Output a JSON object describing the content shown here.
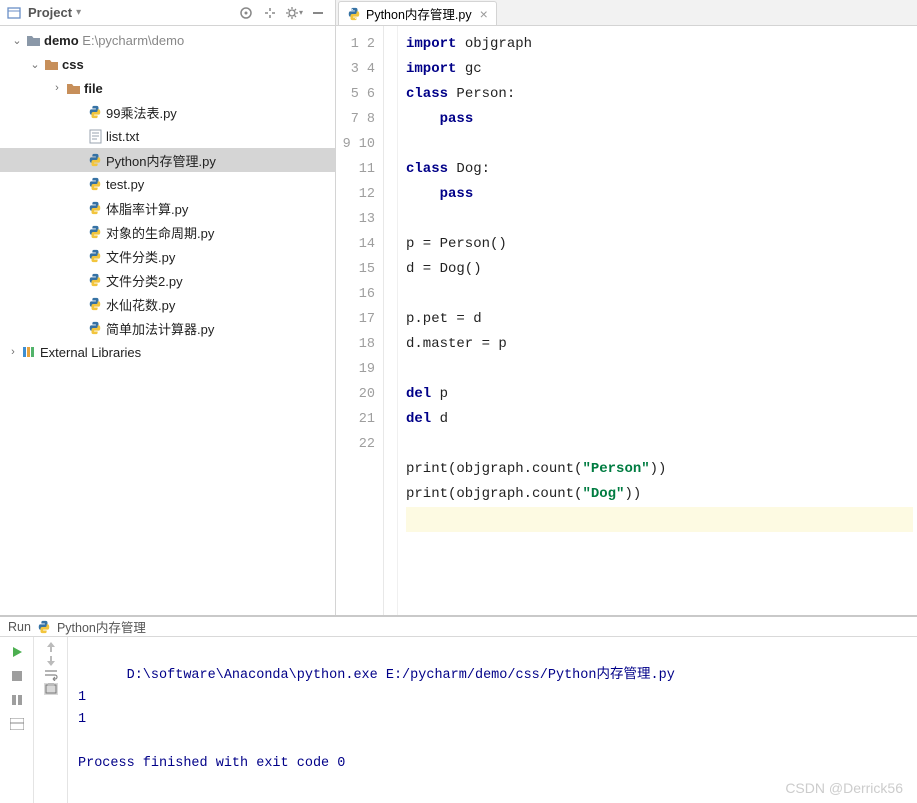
{
  "sidebar": {
    "title": "Project",
    "project": {
      "name": "demo",
      "path": "E:\\pycharm\\demo"
    },
    "folders": {
      "css": "css",
      "file": "file"
    },
    "files": [
      "99乘法表.py",
      "list.txt",
      "Python内存管理.py",
      "test.py",
      "体脂率计算.py",
      "对象的生命周期.py",
      "文件分类.py",
      "文件分类2.py",
      "水仙花数.py",
      "简单加法计算器.py"
    ],
    "external": "External Libraries"
  },
  "editor": {
    "tab": "Python内存管理.py",
    "lines": [
      {
        "n": 1,
        "seg": [
          {
            "t": "import ",
            "c": "kw"
          },
          {
            "t": "objgraph"
          }
        ]
      },
      {
        "n": 2,
        "seg": [
          {
            "t": "import ",
            "c": "kw"
          },
          {
            "t": "gc"
          }
        ]
      },
      {
        "n": 3,
        "seg": [
          {
            "t": "class ",
            "c": "kw"
          },
          {
            "t": "Person:"
          }
        ]
      },
      {
        "n": 4,
        "seg": [
          {
            "t": "    "
          },
          {
            "t": "pass",
            "c": "kw"
          }
        ]
      },
      {
        "n": 5,
        "seg": []
      },
      {
        "n": 6,
        "seg": [
          {
            "t": "class ",
            "c": "kw"
          },
          {
            "t": "Dog:"
          }
        ]
      },
      {
        "n": 7,
        "seg": [
          {
            "t": "    "
          },
          {
            "t": "pass",
            "c": "kw"
          }
        ]
      },
      {
        "n": 8,
        "seg": []
      },
      {
        "n": 9,
        "seg": [
          {
            "t": "p = Person()"
          }
        ]
      },
      {
        "n": 10,
        "seg": [
          {
            "t": "d = Dog()"
          }
        ]
      },
      {
        "n": 11,
        "seg": []
      },
      {
        "n": 12,
        "seg": [
          {
            "t": "p.pet = d"
          }
        ]
      },
      {
        "n": 13,
        "seg": [
          {
            "t": "d.master = p"
          }
        ]
      },
      {
        "n": 14,
        "seg": []
      },
      {
        "n": 15,
        "seg": [
          {
            "t": "del ",
            "c": "kw"
          },
          {
            "t": "p"
          }
        ]
      },
      {
        "n": 16,
        "seg": [
          {
            "t": "del ",
            "c": "kw"
          },
          {
            "t": "d"
          }
        ]
      },
      {
        "n": 17,
        "seg": []
      },
      {
        "n": 18,
        "seg": [
          {
            "t": "print(objgraph.count("
          },
          {
            "t": "\"Person\"",
            "c": "str"
          },
          {
            "t": "))"
          }
        ]
      },
      {
        "n": 19,
        "seg": [
          {
            "t": "print(objgraph.count("
          },
          {
            "t": "\"Dog\"",
            "c": "str"
          },
          {
            "t": "))"
          }
        ]
      },
      {
        "n": 20,
        "seg": [],
        "hl": true
      },
      {
        "n": 21,
        "seg": []
      },
      {
        "n": 22,
        "seg": []
      }
    ]
  },
  "console": {
    "title": "Run",
    "target": "Python内存管理",
    "lines": [
      "D:\\software\\Anaconda\\python.exe E:/pycharm/demo/css/Python内存管理.py",
      "1",
      "1",
      "",
      "Process finished with exit code 0"
    ]
  },
  "watermark": "CSDN @Derrick56"
}
